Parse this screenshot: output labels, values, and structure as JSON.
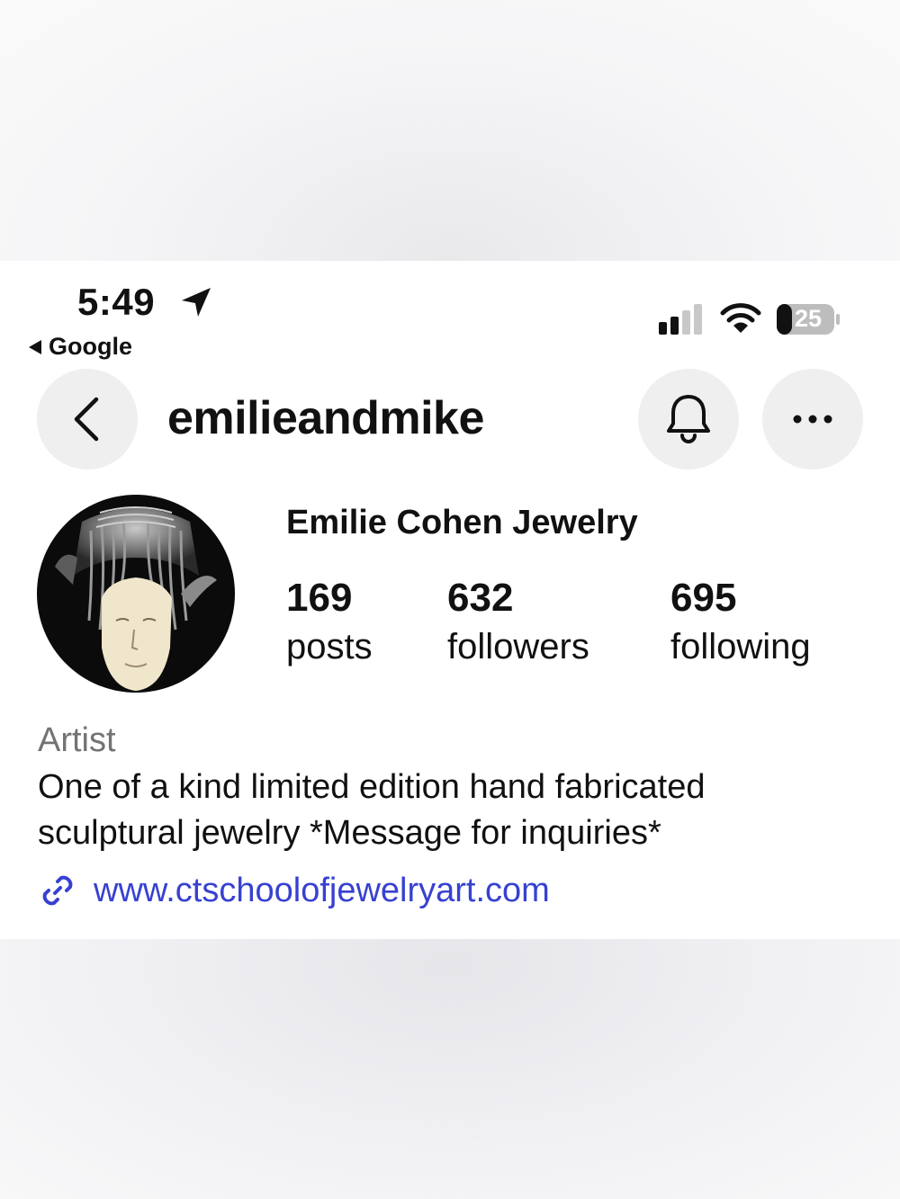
{
  "status_bar": {
    "time": "5:49",
    "back_app": "Google",
    "battery": "25",
    "icons": [
      "location-arrow-icon",
      "signal-icon",
      "wifi-icon",
      "battery-icon"
    ]
  },
  "header": {
    "username": "emilieandmike",
    "icons": [
      "chevron-left-icon",
      "bell-icon",
      "more-icon"
    ]
  },
  "profile": {
    "display_name": "Emilie Cohen Jewelry",
    "stats": [
      {
        "value": "169",
        "label": "posts"
      },
      {
        "value": "632",
        "label": "followers"
      },
      {
        "value": "695",
        "label": "following"
      }
    ],
    "category": "Artist",
    "bio_line1": "One of a kind limited edition hand fabricated",
    "bio_line2": "sculptural jewelry *Message for inquiries*",
    "link": "www.ctschoolofjewelryart.com"
  },
  "colors": {
    "link": "#3741d1",
    "category": "#737373",
    "button_bg": "#efefef",
    "text": "#111111"
  }
}
